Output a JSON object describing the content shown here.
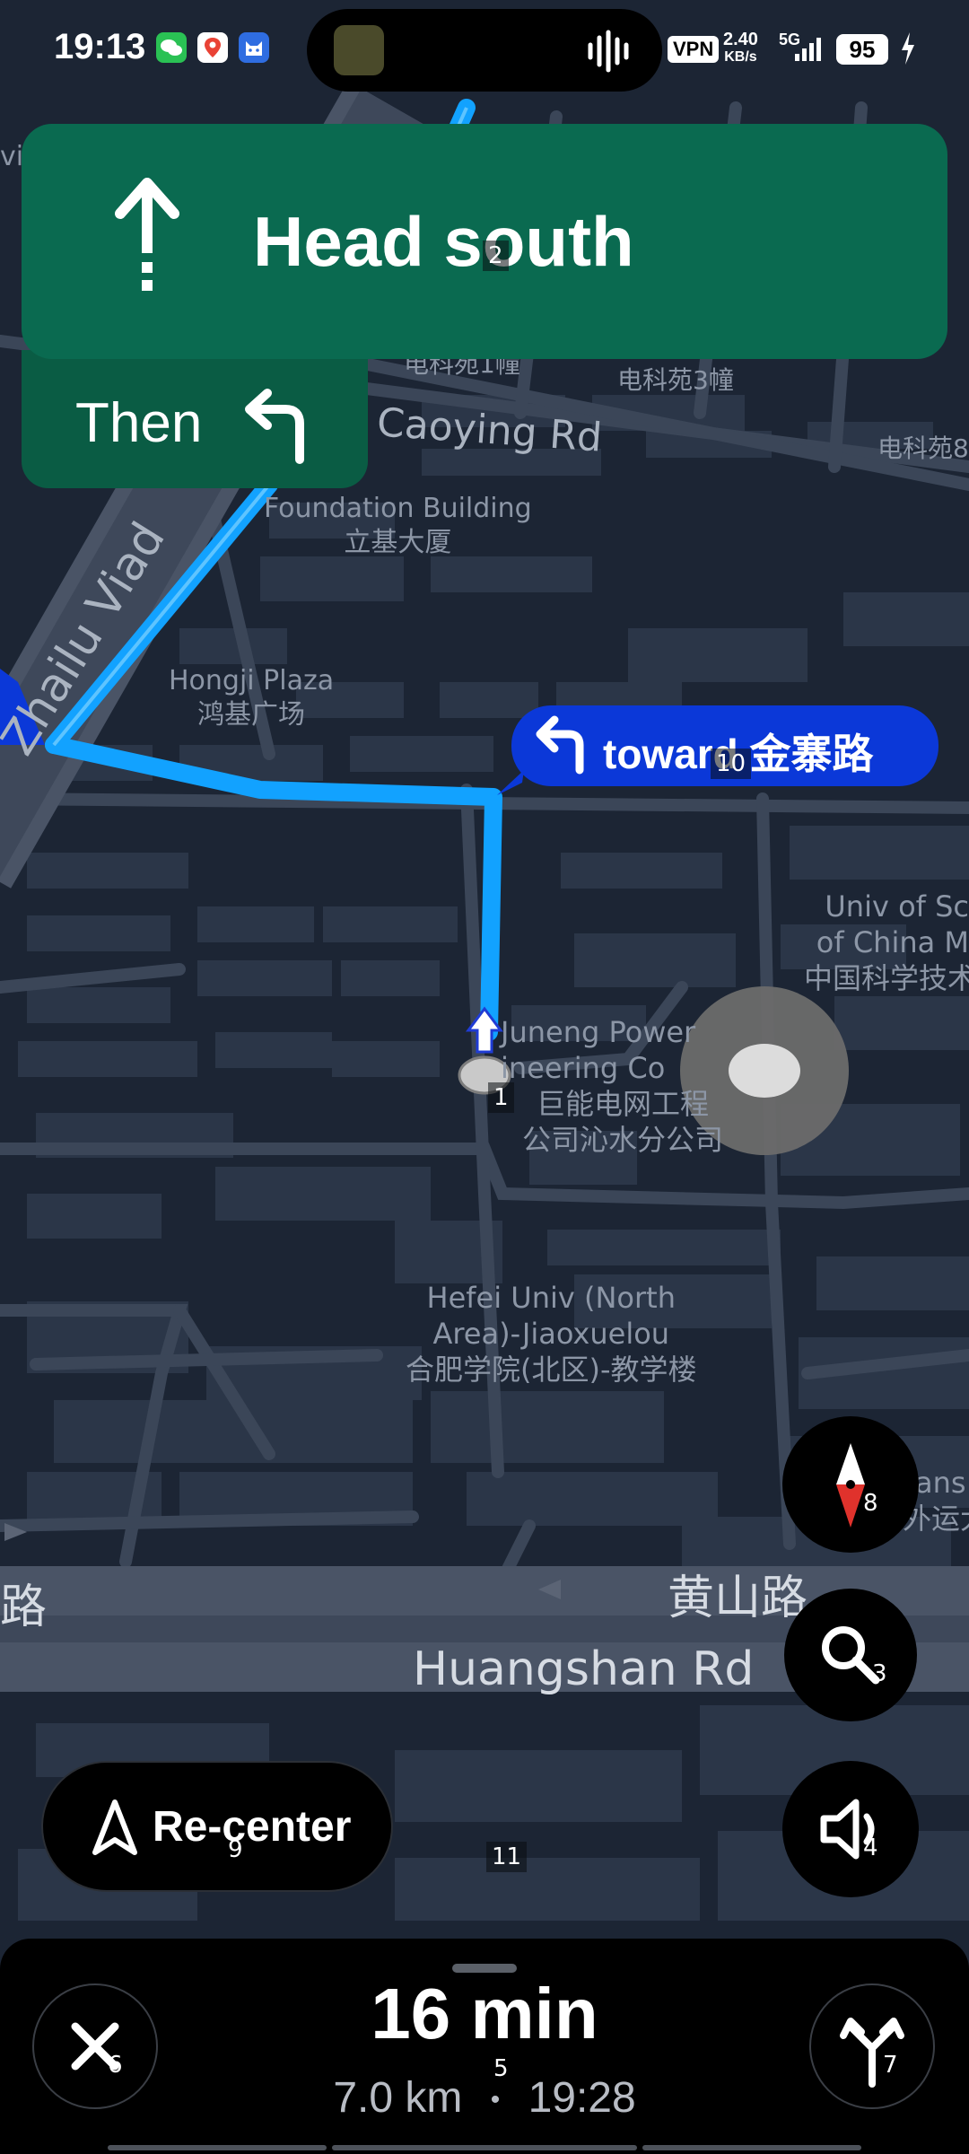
{
  "status_bar": {
    "time": "19:13",
    "vpn": "VPN",
    "net_speed": "2.40",
    "net_unit": "KB/s",
    "network": "5G",
    "battery": "95"
  },
  "banner": {
    "direction": "Head south",
    "then_label": "Then",
    "direction_icon": "straight-arrow-icon",
    "then_icon": "turn-left-icon",
    "color": "#0a6a50"
  },
  "callout": {
    "text": "toward 金寨路",
    "icon": "turn-left-icon",
    "color": "#0b38d8"
  },
  "map_labels": {
    "foundation_en": "Foundation Building",
    "foundation_zh": "立基大厦",
    "hongji_en": "Hongji Plaza",
    "hongji_zh": "鸿基广场",
    "caoying": "Caoying Rd",
    "dianke3": "电科苑3幢",
    "dianke1": "电科苑1幢",
    "dianke8": "电科苑8",
    "zhailu": "Zhailu Viad",
    "univ_1": "Univ of Sc",
    "univ_2": "of China M",
    "univ_3": "中国科学技术",
    "juneng_1": "Juneng Power",
    "juneng_2": "ineering Co",
    "juneng_3": "巨能电网工程",
    "juneng_4": "公司沁水分公司",
    "hefei_1": "Hefei Univ (North",
    "hefei_2": "Area)-Jiaoxuelou",
    "hefei_3": "合肥学院(北区)-教学楼",
    "huangshan_zh": "黄山路",
    "huangshan_en": "Huangshan Rd",
    "lu_left": "路",
    "trans_1": "ans",
    "trans_2": "外运大",
    "edge_vi": "vi"
  },
  "controls": {
    "recenter_label": "Re-center",
    "compass_icon": "compass-icon",
    "search_icon": "search-icon",
    "sound_icon": "sound-icon"
  },
  "trip": {
    "eta_minutes": "16 min",
    "distance": "7.0 km",
    "separator": "•",
    "arrival": "19:28",
    "close_icon": "close-icon",
    "alternates_icon": "route-options-icon"
  },
  "som_markers": [
    "1",
    "2",
    "3",
    "4",
    "5",
    "6",
    "7",
    "8",
    "9",
    "10",
    "11"
  ],
  "colors": {
    "map_bg": "#1c2534",
    "route": "#12a2ff",
    "road": "#3b4658",
    "block": "#2b3648"
  }
}
